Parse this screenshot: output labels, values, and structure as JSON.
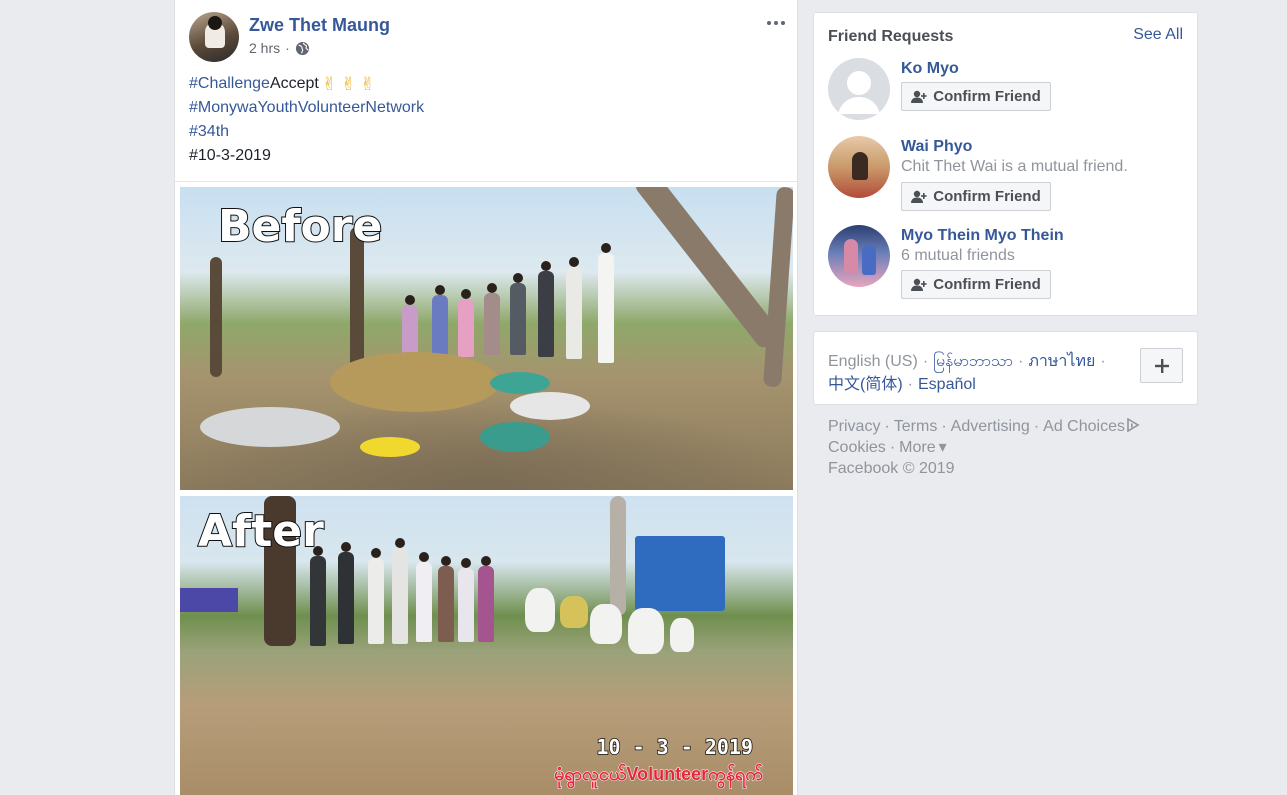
{
  "post": {
    "author": "Zwe Thet Maung",
    "time": "2 hrs",
    "privacy_sep": "·",
    "more_icon": "more-horizontal-icon",
    "globe_icon": "globe-icon",
    "lines": {
      "l1_tag": "#Challenge",
      "l1_text": " Accept",
      "l2_tag": "#MonywaYouthVolunteerNetwork",
      "l3_tag": "#34th",
      "l4_text": "#10-3-2019"
    },
    "photo_before_caption": "Before",
    "photo_after_caption": "After",
    "photo_date": "10 - 3 - 2019",
    "photo_watermark": "မုံရွာလူငယ်Volunteerကွန်ရက်"
  },
  "requests": {
    "title": "Friend Requests",
    "see_all": "See All",
    "confirm_label": "Confirm Friend",
    "items": [
      {
        "name": "Ko Myo",
        "sub": ""
      },
      {
        "name": "Wai Phyo",
        "sub": "Chit Thet Wai is a mutual friend."
      },
      {
        "name": "Myo Thein Myo Thein",
        "sub": "6 mutual friends"
      }
    ]
  },
  "languages": {
    "current": "English (US)",
    "others": [
      "မြန်မာဘာသာ",
      "ภาษาไทย",
      "中文(简体)",
      "Español"
    ],
    "sep": "·"
  },
  "footer": {
    "links": [
      "Privacy",
      "Terms",
      "Advertising",
      "Ad Choices",
      "Cookies",
      "More"
    ],
    "more_suffix": "▾",
    "copyright": "Facebook © 2019",
    "sep": "·"
  },
  "colors": {
    "link": "#365899",
    "muted": "#90949c",
    "background": "#e9ebee"
  }
}
